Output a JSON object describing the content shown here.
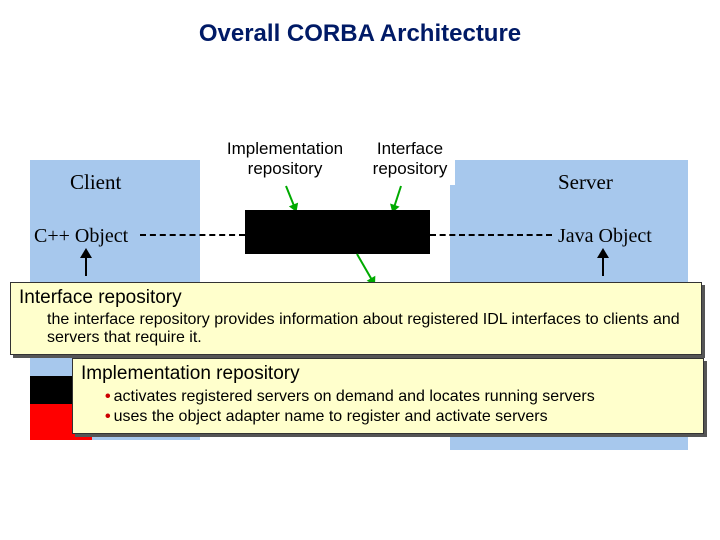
{
  "title": "Overall CORBA Architecture",
  "labels": {
    "client": "Client",
    "server": "Server",
    "impl_repo": "Implementation repository",
    "iface_repo": "Interface repository",
    "cpp_obj": "C++ Object",
    "java_obj": "Java Object"
  },
  "callouts": {
    "iface": {
      "title": "Interface repository",
      "body": "the interface repository provides information about registered IDL interfaces to clients and servers that require it."
    },
    "impl": {
      "title": "Implementation repository",
      "bullets": [
        "activates registered servers on demand and locates running servers",
        "uses the object adapter name to register and activate servers"
      ]
    }
  }
}
